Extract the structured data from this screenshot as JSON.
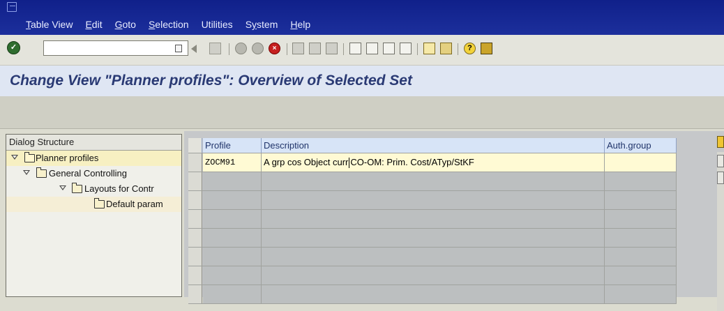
{
  "menubar": {
    "items": [
      {
        "u": "T",
        "rest": "able View"
      },
      {
        "u": "E",
        "rest": "dit"
      },
      {
        "u": "G",
        "rest": "oto"
      },
      {
        "u": "S",
        "rest": "election"
      },
      {
        "u": "",
        "rest": "Utilities"
      },
      {
        "u": "",
        "rest": "System",
        "pre": "S",
        "underline_mid": "y",
        "post": "stem"
      },
      {
        "u": "H",
        "rest": "elp"
      }
    ]
  },
  "toolbar": {
    "command_value": "",
    "icons": [
      "enter-icon",
      "history-icon",
      "back-icon",
      "save-icon",
      "back-green-icon",
      "exit-icon",
      "cancel-icon",
      "print-icon",
      "find-icon",
      "find-next-icon",
      "first-page-icon",
      "prev-page-icon",
      "next-page-icon",
      "last-page-icon",
      "new-session-icon",
      "shortcut-icon",
      "help-icon",
      "layout-icon"
    ]
  },
  "title": "Change View \"Planner profiles\": Overview of Selected Set",
  "dialog": {
    "header": "Dialog Structure",
    "items": [
      {
        "label": "Planner profiles",
        "level": 0,
        "selected": true,
        "expanded": true
      },
      {
        "label": "General Controlling",
        "level": 1,
        "selected": false,
        "expanded": true
      },
      {
        "label": "Layouts for Contr",
        "level": 2,
        "selected": false,
        "expanded": true
      },
      {
        "label": "Default param",
        "level": 3,
        "selected": false,
        "expanded": false
      }
    ]
  },
  "table": {
    "columns": [
      "Profile",
      "Description",
      "Auth.group"
    ],
    "rows": [
      {
        "profile": "ZOCM91",
        "description_a": "A grp cos Object curr",
        "description_b": "CO-OM: Prim. Cost/ATyp/StKF",
        "auth": ""
      }
    ]
  },
  "colors": {
    "menubar": "#10208a",
    "title": "#2a3a74",
    "selected": "#f7f0c2",
    "input_row": "#fffad4"
  }
}
